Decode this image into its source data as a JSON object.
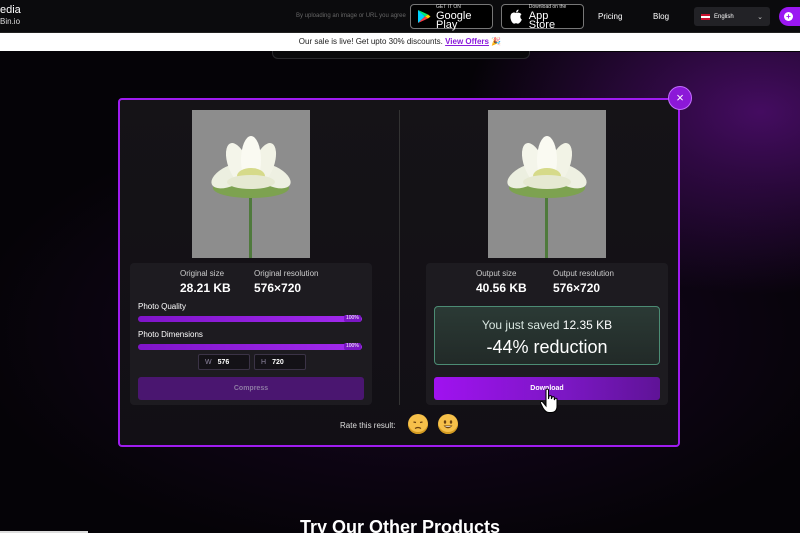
{
  "header": {
    "logo_line1": "edia",
    "logo_line2": "Bin.io",
    "hint_text": "By uploading an image or URL you agree",
    "google_play": {
      "small": "GET IT ON",
      "big": "Google Play"
    },
    "app_store": {
      "small": "Download on the",
      "big": "App Store"
    },
    "pricing_label": "Pricing",
    "blog_label": "Blog",
    "language_label": "English"
  },
  "sale_banner": {
    "text": "Our sale is live! Get upto 30% discounts.",
    "link_label": "View Offers",
    "emoji": "🎉"
  },
  "modal": {
    "close_label": "×",
    "original": {
      "size_label": "Original size",
      "size_value": "28.21 KB",
      "resolution_label": "Original resolution",
      "resolution_value": "576×720",
      "quality_label": "Photo Quality",
      "quality_pct": "100%",
      "quality_value": 1.0,
      "dimensions_label": "Photo Dimensions",
      "dimensions_pct": "100%",
      "dimensions_value": 1.0,
      "width_key": "W",
      "width_value": "576",
      "height_key": "H",
      "height_value": "720",
      "compress_label": "Compress"
    },
    "output": {
      "size_label": "Output size",
      "size_value": "40.56 KB",
      "resolution_label": "Output resolution",
      "resolution_value": "576×720",
      "saved_prefix": "You just saved",
      "saved_amount": "12.35 KB",
      "reduction_text": "-44% reduction",
      "download_label": "Download"
    },
    "rate_label": "Rate this result:",
    "rate_icons": [
      "sad-face-icon",
      "smile-face-icon"
    ]
  },
  "section_title": "Try Our Other Products",
  "colors": {
    "accent": "#9b17f2",
    "modal_border": "#9f1cf0",
    "saved_border": "#4c8c74"
  }
}
